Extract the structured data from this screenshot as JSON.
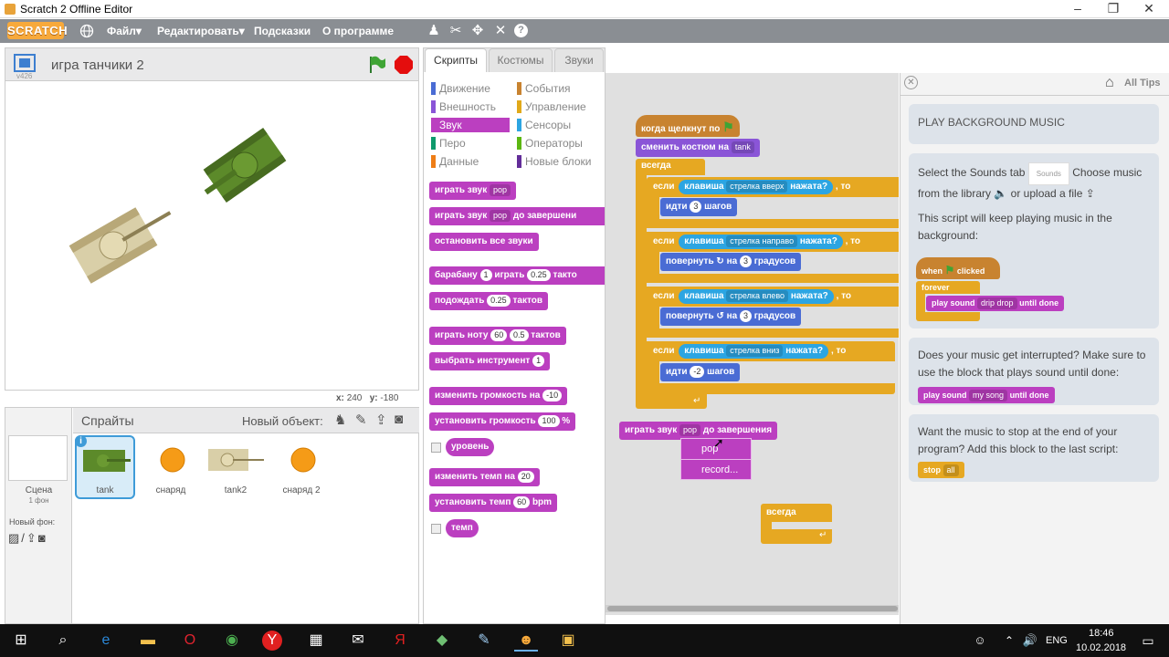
{
  "window": {
    "title": "Scratch 2 Offline Editor",
    "minimize": "–",
    "maximize": "❐",
    "close": "✕"
  },
  "menu": {
    "logo": "SCRATCH",
    "file": "Файл▾",
    "edit": "Редактировать▾",
    "tips": "Подсказки",
    "about": "О программе"
  },
  "stage": {
    "project_name": "игра танчики 2",
    "version": "v426",
    "x_label": "x:",
    "x": "240",
    "y_label": "y:",
    "y": "-180"
  },
  "sprites": {
    "header": "Спрайты",
    "new_object": "Новый объект:",
    "scene_label": "Сцена",
    "scene_sub": "1 фон",
    "new_backdrop": "Новый фон:",
    "items": [
      {
        "name": "tank"
      },
      {
        "name": "снаряд"
      },
      {
        "name": "tank2"
      },
      {
        "name": "снаряд 2"
      }
    ]
  },
  "tabs": {
    "scripts": "Скрипты",
    "costumes": "Костюмы",
    "sounds": "Звуки"
  },
  "categories": [
    {
      "label": "Движение",
      "color": "#4a6cd4"
    },
    {
      "label": "События",
      "color": "#c88330"
    },
    {
      "label": "Внешность",
      "color": "#8a55d7"
    },
    {
      "label": "Управление",
      "color": "#e1a91a"
    },
    {
      "label": "Звук",
      "color": "#bb3fc0"
    },
    {
      "label": "Сенсоры",
      "color": "#2ca5e2"
    },
    {
      "label": "Перо",
      "color": "#0e9a6c"
    },
    {
      "label": "Операторы",
      "color": "#5cb712"
    },
    {
      "label": "Данные",
      "color": "#ee7d16"
    },
    {
      "label": "Новые блоки",
      "color": "#632d99"
    }
  ],
  "palette": {
    "play_sound": "играть звук",
    "pop": "pop",
    "until_done": "до завершени",
    "stop_all_sounds": "остановить все звуки",
    "drum": "барабану",
    "drum_n": "1",
    "play": "играть",
    "beats_v": "0.25",
    "beats": "такто",
    "wait": "подождать",
    "wait_v": "0.25",
    "wait_unit": "тактов",
    "play_note": "играть ноту",
    "note": "60",
    "note_beats": "0.5",
    "note_unit": "тактов",
    "instrument": "выбрать инструмент",
    "instrument_n": "1",
    "change_volume": "изменить громкость на",
    "change_volume_v": "-10",
    "set_volume": "установить громкость",
    "set_volume_v": "100",
    "percent": "%",
    "volume_reporter": "уровень",
    "change_tempo": "изменить темп на",
    "change_tempo_v": "20",
    "set_tempo": "установить темп",
    "set_tempo_v": "60",
    "bpm": "bpm",
    "tempo_reporter": "темп"
  },
  "script": {
    "hat": "когда щелкнут по",
    "switch_costume": "сменить костюм на",
    "costume": "tank",
    "forever": "всегда",
    "if": "если",
    "key": "клавиша",
    "pressed": "нажата?",
    "then": ", то",
    "key_up": "стрелка вверх",
    "key_right": "стрелка направо",
    "key_left": "стрелка влево",
    "key_down": "стрелка вниз",
    "move": "идти",
    "move_v": "3",
    "move_v2": "-2",
    "steps": "шагов",
    "turn": "повернуть",
    "on": "на",
    "turn_v": "3",
    "degrees": "градусов",
    "loose_play": "играть звук",
    "loose_pop": "pop",
    "loose_until": "до завершения",
    "dropdown_items": [
      "pop",
      "record..."
    ],
    "loose_forever": "всегда"
  },
  "tips": {
    "all_tips": "All Tips",
    "heading": "PLAY BACKGROUND MUSIC",
    "p1a": "Select the Sounds tab",
    "sounds_tab": "Sounds",
    "p1b": "Choose music from the library",
    "p1c": "or upload a file",
    "p2": "This script will keep playing music in the background:",
    "when": "when",
    "clicked": "clicked",
    "forever": "forever",
    "play_sound": "play sound",
    "drip": "drip drop",
    "until_done": "until done",
    "p3": "Does your music get interrupted? Make sure to use the block that plays sound until done:",
    "my_song": "my song",
    "p4": "Want the music to stop at the end of your program? Add this block to the last script:",
    "stop": "stop",
    "all": "all"
  },
  "taskbar": {
    "lang": "ENG",
    "time": "18:46",
    "date": "10.02.2018"
  },
  "colors": {
    "menubar": "#8a8e93",
    "sound": "#bb3fc0",
    "control": "#e6a822",
    "sensing": "#2ca5e2",
    "motion": "#4a6cd4",
    "looks": "#8a55d7",
    "events": "#c88330"
  }
}
